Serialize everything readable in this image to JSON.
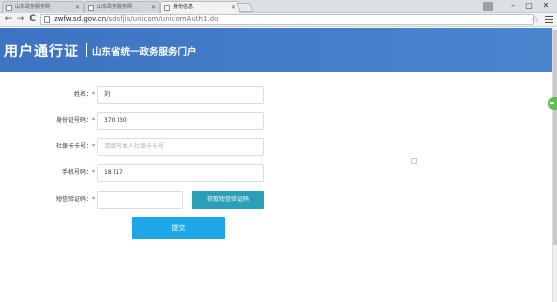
{
  "tabs": [
    {
      "title": "山东政务服务网",
      "active": false
    },
    {
      "title": "山东政务服务网",
      "active": false
    },
    {
      "title": "身份信息",
      "active": true
    }
  ],
  "window_controls": {
    "minimize": "–",
    "maximize": "▢",
    "close": "✕"
  },
  "toolbar": {
    "back": "←",
    "forward": "→",
    "reload": "C",
    "url_host": "zwfw.sd.gov.cn",
    "url_path": "/sdsfjis/unicom/unicomAuth1.do",
    "star": "☆"
  },
  "banner": {
    "brand": "用户通行证",
    "subtitle": "山东省统一政务服务门户",
    "color": "#3d73c2"
  },
  "form": {
    "name": {
      "label": "姓名：",
      "required": "*",
      "value": "刘"
    },
    "id_number": {
      "label": "身份证号码：",
      "required": "*",
      "value": "370                    l30"
    },
    "social_card": {
      "label": "社保卡卡号：",
      "required": "*",
      "placeholder": "请填写本人社保卡卡号"
    },
    "phone": {
      "label": "手机号码：",
      "required": "*",
      "value": "18              l17"
    },
    "sms_code": {
      "label": "短信验证码：",
      "required": "*",
      "value": ""
    },
    "sms_button": "获取短信验证码",
    "submit": "提交"
  }
}
